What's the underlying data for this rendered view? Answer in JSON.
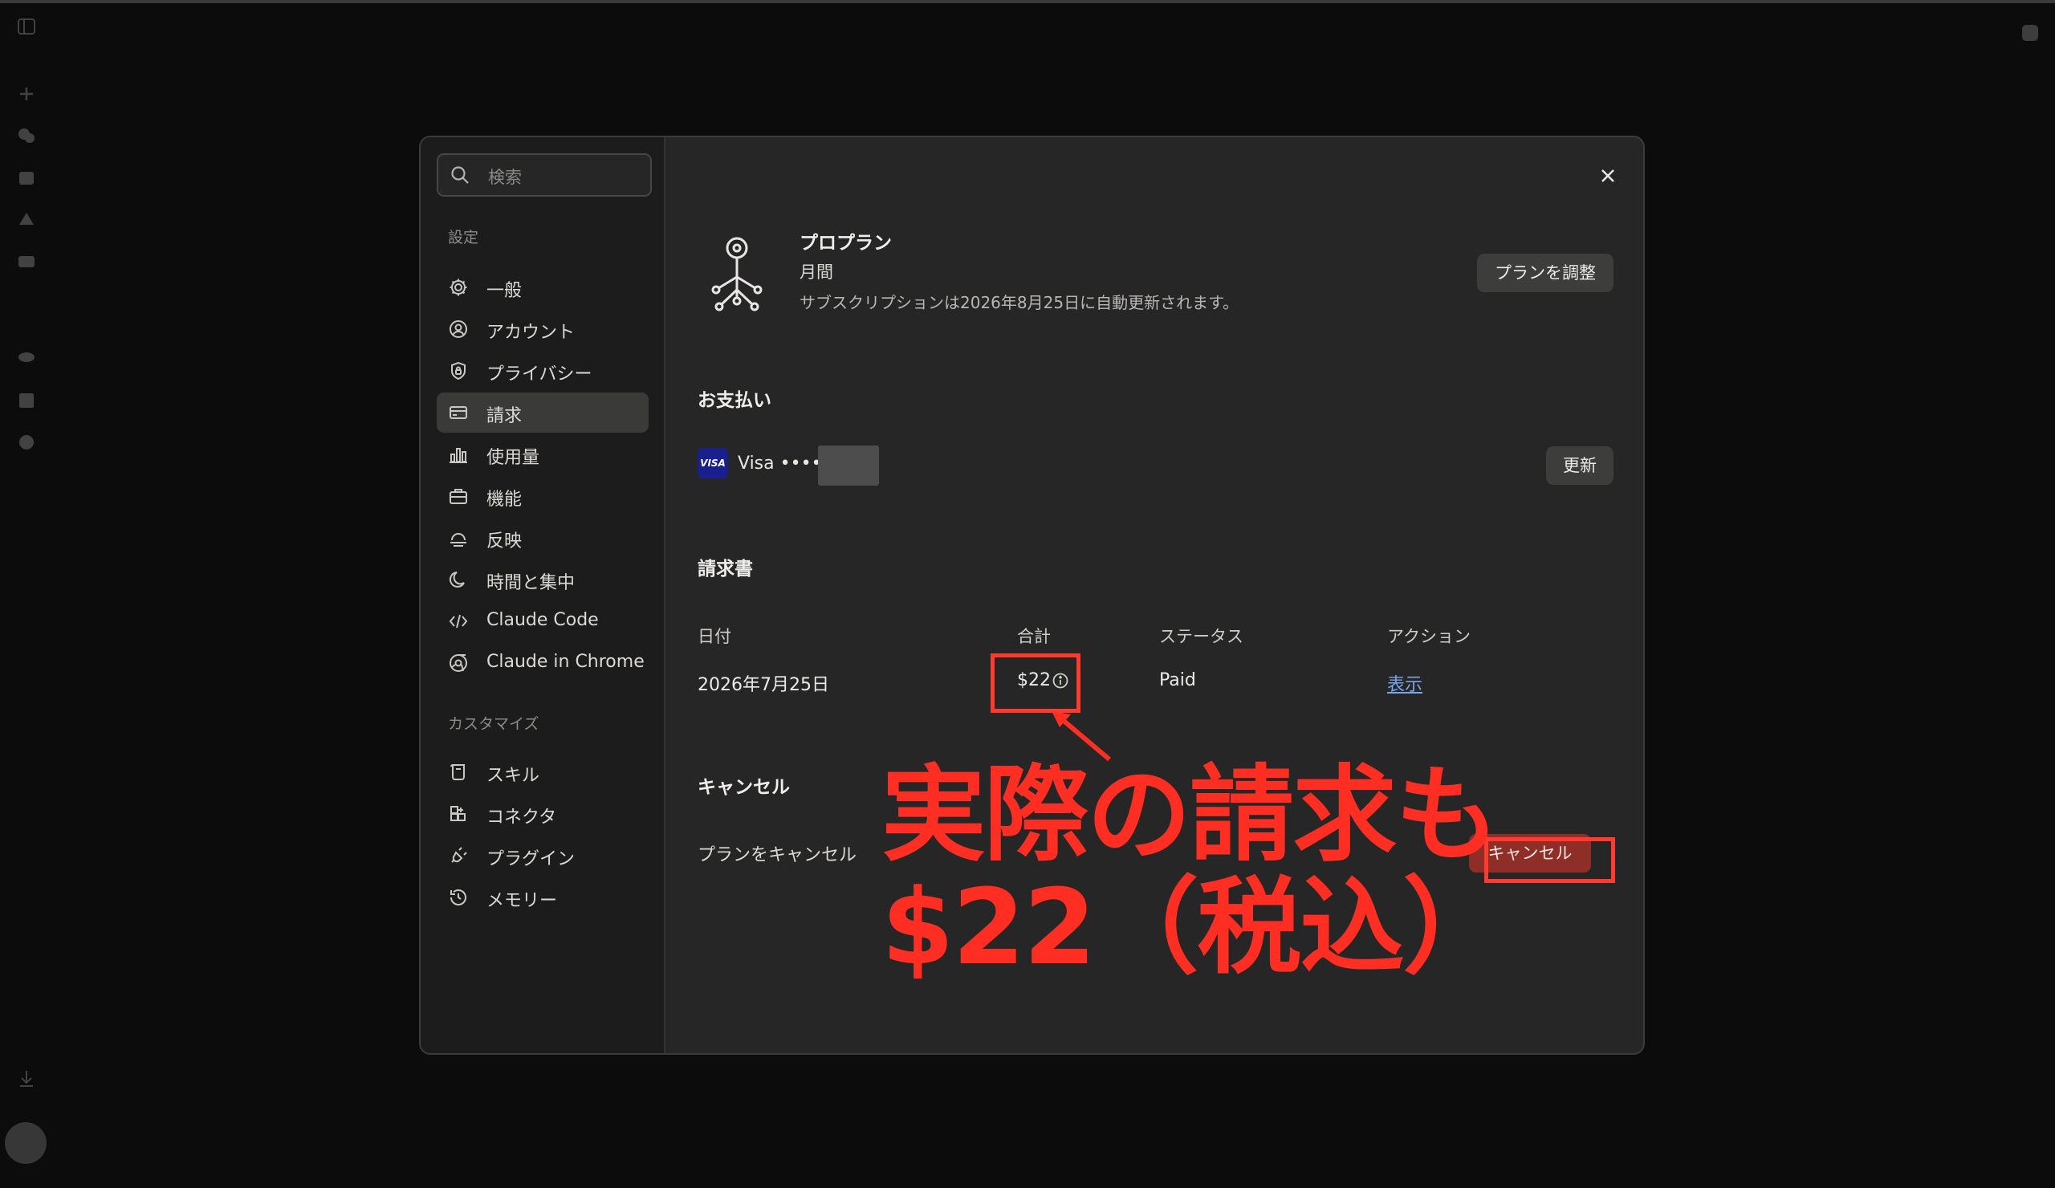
{
  "sidebar": {
    "search_placeholder": "検索",
    "section_settings": "設定",
    "settings_items": [
      {
        "label": "一般",
        "icon": "gear-icon"
      },
      {
        "label": "アカウント",
        "icon": "user-circle-icon"
      },
      {
        "label": "プライバシー",
        "icon": "shield-icon"
      },
      {
        "label": "請求",
        "icon": "credit-card-icon",
        "active": true
      },
      {
        "label": "使用量",
        "icon": "bar-chart-icon"
      },
      {
        "label": "機能",
        "icon": "briefcase-icon"
      },
      {
        "label": "反映",
        "icon": "dome-icon"
      },
      {
        "label": "時間と集中",
        "icon": "moon-icon"
      },
      {
        "label": "Claude Code",
        "icon": "code-icon"
      },
      {
        "label": "Claude in Chrome",
        "icon": "globe-icon"
      }
    ],
    "section_customize": "カスタマイズ",
    "customize_items": [
      {
        "label": "スキル",
        "icon": "scroll-icon"
      },
      {
        "label": "コネクタ",
        "icon": "connector-icon"
      },
      {
        "label": "プラグイン",
        "icon": "plug-icon"
      },
      {
        "label": "メモリー",
        "icon": "history-icon"
      }
    ]
  },
  "plan": {
    "name": "プロプラン",
    "cycle": "月間",
    "renewal": "サブスクリプションは2026年8月25日に自動更新されます。",
    "adjust_button": "プランを調整"
  },
  "payment": {
    "title": "お支払い",
    "card_brand_badge": "VISA",
    "card_text": "Visa ••••",
    "update_button": "更新"
  },
  "invoices": {
    "title": "請求書",
    "headers": {
      "date": "日付",
      "total": "合計",
      "status": "ステータス",
      "action": "アクション"
    },
    "rows": [
      {
        "date": "2026年7月25日",
        "total": "$22",
        "status": "Paid",
        "action": "表示"
      }
    ]
  },
  "cancel": {
    "title": "キャンセル",
    "label": "プランをキャンセル",
    "button": "キャンセル"
  },
  "annotation": {
    "line1": "実際の請求も",
    "line2": "$22（税込）",
    "color": "#ff2e22"
  }
}
